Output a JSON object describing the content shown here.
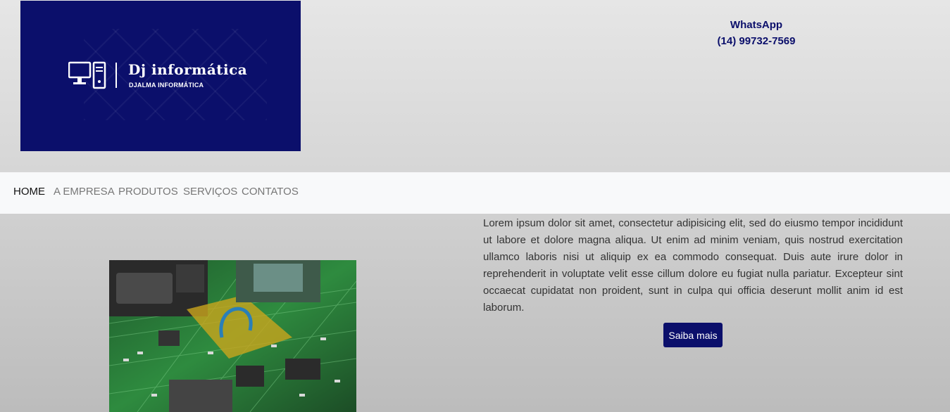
{
  "logo": {
    "title": "Dj informática",
    "subtitle": "DJALMA INFORMÁTICA",
    "background": "#0b0f6b",
    "icon": "computer-icon"
  },
  "contact": {
    "label": "WhatsApp",
    "phone": "(14) 99732-7569",
    "color": "#0b0f6b"
  },
  "nav": {
    "items": [
      {
        "label": "HOME",
        "active": true
      },
      {
        "label": "A EMPRESA",
        "active": false
      },
      {
        "label": "PRODUTOS",
        "active": false
      },
      {
        "label": "SERVIÇOS",
        "active": false
      },
      {
        "label": "CONTATOS",
        "active": false
      }
    ]
  },
  "main": {
    "image": "circuit-board-photo",
    "paragraph": "Lorem ipsum dolor sit amet, consectetur adipisicing elit, sed do eiusmo tempor incididunt ut labore et dolore magna aliqua. Ut enim ad minim veniam, quis nostrud exercitation ullamco laboris nisi ut aliquip ex ea commodo consequat. Duis aute irure dolor in reprehenderit in voluptate velit esse cillum dolore eu fugiat nulla pariatur. Excepteur sint occaecat cupidatat non proident, sunt in culpa qui officia deserunt mollit anim id est laborum.",
    "button_label": "Saiba mais",
    "button_color": "#0b0f6b"
  }
}
